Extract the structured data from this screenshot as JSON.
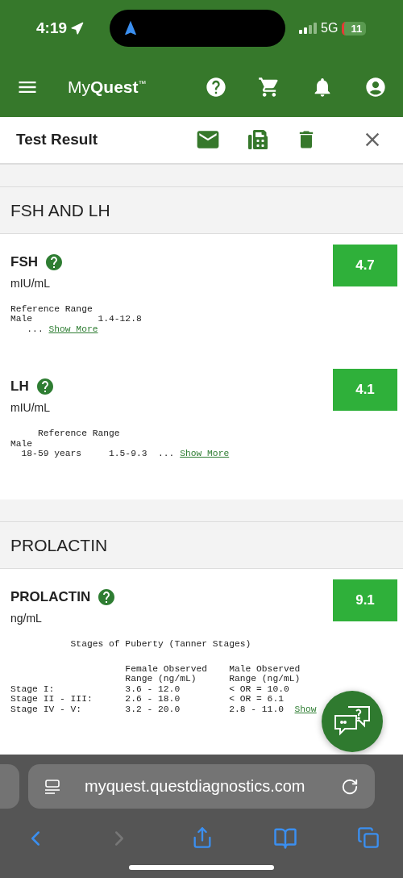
{
  "status_bar": {
    "time": "4:19",
    "network": "5G",
    "battery": "11"
  },
  "header": {
    "logo": "My**Quest**$^{™}$"
  },
  "toolbar": {
    "title": "Test Result"
  },
  "sections": [
    {
      "title": "FSH AND LH",
      "tests": [
        {
          "name": "FSH",
          "unit": "mIU/mL",
          "value": "4.7",
          "reference": {
            "lines": [
              "Reference Range",
              "Male            1.4-12.8"
            ],
            "last_line": "   ... ",
            "link": "Show More"
          }
        },
        {
          "name": "LH",
          "unit": "mIU/mL",
          "value": "4.1",
          "reference": {
            "lines": [
              "     Reference Range",
              "Male"
            ],
            "last_line": "  18-59 years     1.5-9.3  ... ",
            "link": "Show More"
          }
        }
      ]
    },
    {
      "title": "PROLACTIN",
      "tests": [
        {
          "name": "PROLACTIN",
          "unit": "ng/mL",
          "value": "9.1",
          "reference": {
            "heading": "           Stages of Puberty (Tanner Stages)",
            "lines": [
              "                     Female Observed    Male Observed",
              "                     Range (ng/mL)      Range (ng/mL)",
              "Stage I:             3.6 - 12.0         < OR = 10.0",
              "Stage II - III:      2.6 - 18.0         < OR = 6.1"
            ],
            "last_line": "Stage IV - V:        3.2 - 20.0         2.8 - 11.0  ",
            "link": "Show"
          }
        }
      ]
    }
  ],
  "browser": {
    "url": "myquest.questdiagnostics.com",
    "nav": [
      {
        "kind": "back",
        "disabled": false
      },
      {
        "kind": "forward",
        "disabled": true
      },
      {
        "kind": "share",
        "disabled": false
      },
      {
        "kind": "bookmarks",
        "disabled": false
      },
      {
        "kind": "tabs",
        "disabled": false
      }
    ]
  }
}
